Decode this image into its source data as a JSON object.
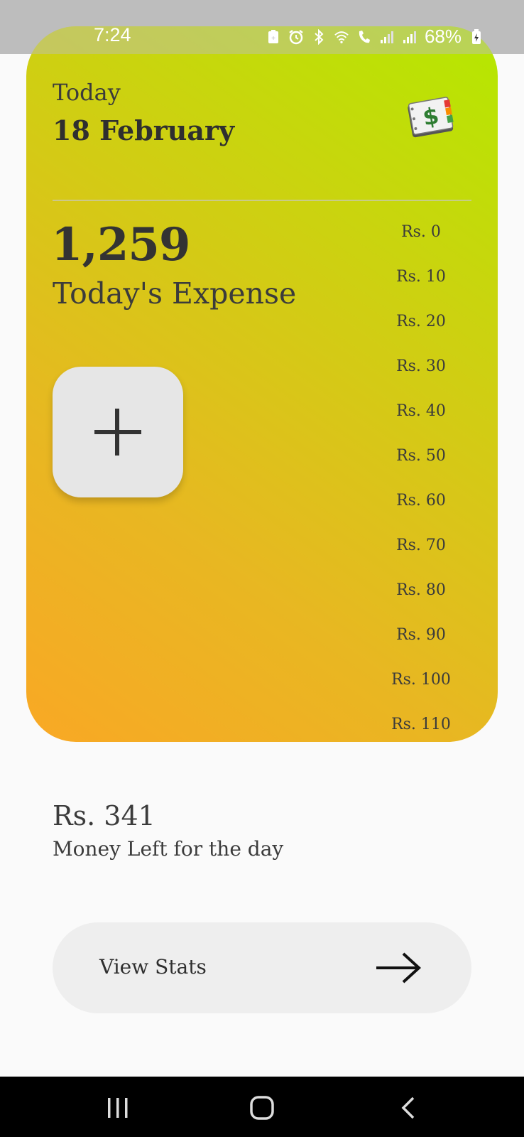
{
  "status_bar": {
    "time": "7:24",
    "battery": "68%",
    "icons": [
      "battery-saver-icon",
      "alarm-icon",
      "bluetooth-icon",
      "wifi-icon",
      "call-icon",
      "signal-icon",
      "signal-icon",
      "battery-charging-icon"
    ]
  },
  "card": {
    "today_label": "Today",
    "date": "18 February",
    "expense_amount": "1,259",
    "expense_label": "Today's Expense",
    "icon": "ledger-dollar-icon",
    "add_icon": "plus-icon",
    "amount_options": [
      "Rs. 0",
      "Rs. 10",
      "Rs. 20",
      "Rs. 30",
      "Rs. 40",
      "Rs. 50",
      "Rs. 60",
      "Rs. 70",
      "Rs. 80",
      "Rs. 90",
      "Rs. 100",
      "Rs. 110"
    ],
    "gradient": [
      "#f9a825",
      "#b5e800"
    ]
  },
  "money_left": {
    "amount": "Rs. 341",
    "label": "Money Left for the day"
  },
  "view_stats": {
    "label": "View Stats",
    "icon": "arrow-right-icon"
  },
  "nav": {
    "buttons": [
      "recent-apps-icon",
      "home-icon",
      "back-icon"
    ]
  }
}
